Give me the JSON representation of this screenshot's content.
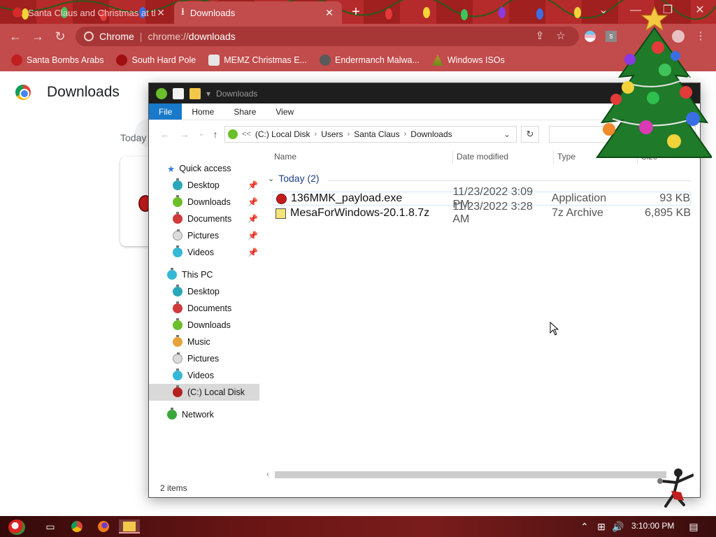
{
  "browser": {
    "tabs": [
      {
        "title": "Santa Claus and Christmas at the",
        "active": false
      },
      {
        "title": "Downloads",
        "active": true
      }
    ],
    "new_tab_icon": "+",
    "omnibox": {
      "site_label": "Chrome",
      "url_scheme": "chrome://",
      "url_path": "downloads"
    },
    "bookmarks": [
      {
        "label": "Santa Bombs Arabs",
        "icon": "santa-icon"
      },
      {
        "label": "South Hard Pole",
        "icon": "star-icon"
      },
      {
        "label": "MEMZ Christmas E...",
        "icon": "page-icon"
      },
      {
        "label": "Endermanch Malwa...",
        "icon": "raccoon-icon"
      },
      {
        "label": "Windows ISOs",
        "icon": "tree-icon"
      }
    ],
    "theme_color": "#c24b4b"
  },
  "downloads_page": {
    "title": "Downloads",
    "group_label": "Today"
  },
  "explorer": {
    "title": "Downloads",
    "ribbon_tabs": [
      "File",
      "Home",
      "Share",
      "View"
    ],
    "address": {
      "prefix": "<<",
      "crumbs": [
        "(C:) Local Disk",
        "Users",
        "Santa Claus",
        "Downloads"
      ]
    },
    "nav": {
      "quick_access": "Quick access",
      "quick_items": [
        {
          "label": "Desktop",
          "color": "#2aa7b8"
        },
        {
          "label": "Downloads",
          "color": "#6bbf2a"
        },
        {
          "label": "Documents",
          "color": "#d03a3a"
        },
        {
          "label": "Pictures",
          "color": "#dcdcdc"
        },
        {
          "label": "Videos",
          "color": "#35b7d6"
        }
      ],
      "this_pc": "This PC",
      "pc_items": [
        {
          "label": "Desktop",
          "color": "#2aa7b8"
        },
        {
          "label": "Documents",
          "color": "#d03a3a"
        },
        {
          "label": "Downloads",
          "color": "#6bbf2a"
        },
        {
          "label": "Music",
          "color": "#e8a23a"
        },
        {
          "label": "Pictures",
          "color": "#dcdcdc"
        },
        {
          "label": "Videos",
          "color": "#35b7d6"
        },
        {
          "label": "(C:) Local Disk",
          "color": "#b52020"
        }
      ],
      "network": "Network"
    },
    "columns": {
      "name": "Name",
      "date": "Date modified",
      "type": "Type",
      "size": "Size"
    },
    "group": "Today (2)",
    "files": [
      {
        "name": "136MMK_payload.exe",
        "date": "11/23/2022 3:09 PM",
        "type": "Application",
        "size": "93 KB",
        "icon": "red-ornament-icon"
      },
      {
        "name": "MesaForWindows-20.1.8.7z",
        "date": "11/23/2022 3:28 AM",
        "type": "7z Archive",
        "size": "6,895 KB",
        "icon": "archive-icon"
      }
    ],
    "status": "2 items"
  },
  "taskbar": {
    "clock": "3:10:00 PM"
  }
}
